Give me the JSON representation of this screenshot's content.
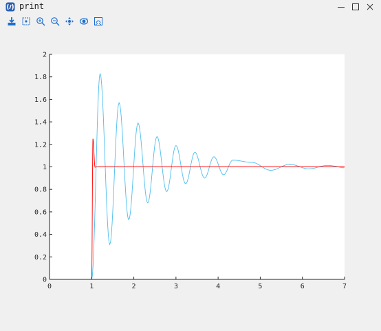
{
  "window": {
    "title": "print",
    "controls": [
      "minimize",
      "maximize",
      "close"
    ]
  },
  "toolbar": {
    "tools": [
      {
        "name": "save-icon"
      },
      {
        "name": "data-cursor-icon"
      },
      {
        "name": "zoom-in-icon"
      },
      {
        "name": "zoom-out-icon"
      },
      {
        "name": "pan-icon"
      },
      {
        "name": "rotate-icon"
      },
      {
        "name": "restore-view-icon"
      }
    ]
  },
  "colors": {
    "series_1": "#4dbeee",
    "series_2": "#ff0000",
    "axes_bg": "#ffffff",
    "figure_bg": "#f0f0f0"
  },
  "chart_data": {
    "type": "line",
    "title": "",
    "xlabel": "",
    "ylabel": "",
    "xlim": [
      0,
      7
    ],
    "ylim": [
      0,
      2
    ],
    "xticks": [
      0,
      1,
      2,
      3,
      4,
      5,
      6,
      7
    ],
    "yticks": [
      0,
      0.2,
      0.4,
      0.6,
      0.8,
      1,
      1.2,
      1.4,
      1.6,
      1.8,
      2
    ],
    "grid": false,
    "legend": "none",
    "series": [
      {
        "color": "#4dbeee",
        "step_time": 1,
        "final_value": 1,
        "peaks": [
          {
            "x": 1.2,
            "y": 1.83
          },
          {
            "x": 1.65,
            "y": 1.57
          },
          {
            "x": 2.1,
            "y": 1.39
          },
          {
            "x": 2.55,
            "y": 1.27
          },
          {
            "x": 3.0,
            "y": 1.19
          },
          {
            "x": 3.45,
            "y": 1.13
          },
          {
            "x": 3.9,
            "y": 1.09
          },
          {
            "x": 4.35,
            "y": 1.06
          },
          {
            "x": 4.8,
            "y": 1.04
          }
        ],
        "troughs": [
          {
            "x": 1.43,
            "y": 0.31
          },
          {
            "x": 1.88,
            "y": 0.53
          },
          {
            "x": 2.33,
            "y": 0.68
          },
          {
            "x": 2.78,
            "y": 0.78
          },
          {
            "x": 3.23,
            "y": 0.85
          },
          {
            "x": 3.68,
            "y": 0.9
          },
          {
            "x": 4.13,
            "y": 0.93
          }
        ]
      },
      {
        "color": "#ff0000",
        "step_time": 1,
        "final_value": 1,
        "peak": {
          "x": 1.03,
          "y": 1.25
        },
        "settling_time": 1.15
      }
    ]
  }
}
